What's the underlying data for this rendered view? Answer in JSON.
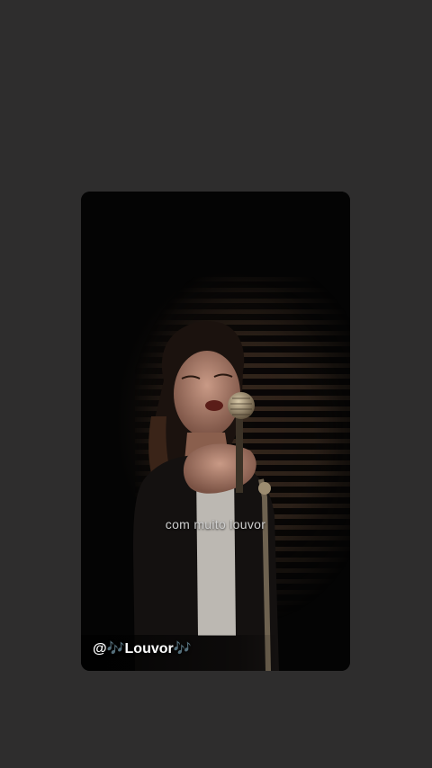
{
  "story": {
    "caption": "com muito louvor",
    "handle": "@🎶Louvor🎶"
  },
  "colors": {
    "screen_background": "#2e2d2d",
    "card_background": "#050505",
    "caption_text": "#cfcfcf",
    "handle_text": "#ffffff"
  }
}
